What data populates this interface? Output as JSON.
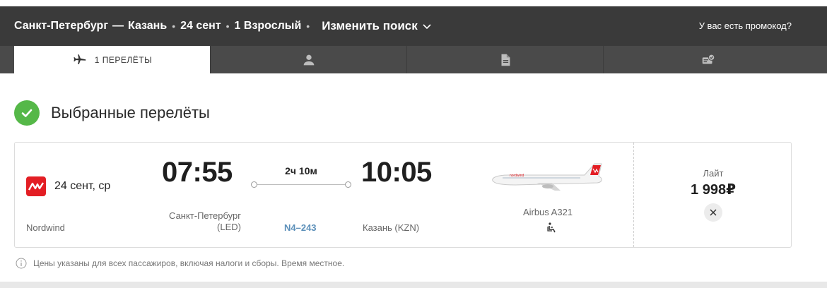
{
  "header": {
    "origin": "Санкт-Петербург",
    "dash": "—",
    "destination": "Казань",
    "date": "24 сент",
    "passengers": "1 Взрослый",
    "change_search": "Изменить поиск",
    "promo": "У вас есть промокод?"
  },
  "tabs": [
    {
      "icon": "airplane-icon",
      "label": "1  ПЕРЕЛЁТЫ",
      "active": true
    },
    {
      "icon": "person-icon",
      "label": ""
    },
    {
      "icon": "document-icon",
      "label": ""
    },
    {
      "icon": "ticket-check-icon",
      "label": ""
    }
  ],
  "section": {
    "title": "Выбранные перелёты"
  },
  "flight": {
    "airline": "Nordwind",
    "date": "24 сент, ср",
    "departure_time": "07:55",
    "arrival_time": "10:05",
    "duration": "2ч 10м",
    "departure_city": "Санкт-Петербург",
    "departure_code": "(LED)",
    "arrival_city": "Казань (KZN)",
    "flight_number": "N4–243",
    "aircraft": "Airbus A321",
    "fare_name": "Лайт",
    "price": "1 998₽"
  },
  "note": "Цены указаны для всех пассажиров, включая налоги и сборы. Время местное.",
  "colors": {
    "header_bg": "#3a3a3a",
    "tabs_bg": "#4a4a4a",
    "success": "#55b848",
    "brand_red": "#e31e24",
    "link": "#5b8fb9"
  }
}
